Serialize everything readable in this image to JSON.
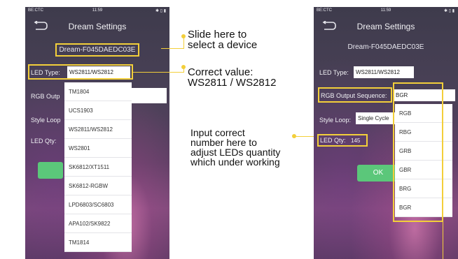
{
  "status": {
    "carrier": "BE:CTC",
    "time": "11:59",
    "icons": "✱ ▯ ▮"
  },
  "nav": {
    "title": "Dream Settings"
  },
  "device_name": "Dream-F045DAEDC03E",
  "left": {
    "led_type_label": "LED Type:",
    "led_type_value": "WS2811/WS2812",
    "rgb_label": "RGB Outp",
    "style_label": "Style Loop",
    "qty_label": "LED Qty:",
    "options": [
      "TM1804",
      "UCS1903",
      "WS2811/WS2812",
      "WS2801",
      "SK6812/XT1511",
      "SK6812-RGBW",
      "LPD6803/SC6803",
      "APA102/SK9822",
      "TM1814"
    ]
  },
  "right": {
    "led_type_label": "LED Type:",
    "led_type_value": "WS2811/WS2812",
    "rgb_label": "RGB Output Sequence:",
    "rgb_value": "BGR",
    "style_label": "Style Loop:",
    "style_value": "Single Cycle",
    "qty_label": "LED Qty:",
    "qty_value": "145",
    "ok_label": "OK",
    "options": [
      "RGB",
      "RBG",
      "GRB",
      "GBR",
      "BRG",
      "BGR"
    ]
  },
  "annotations": {
    "slide_1": "Slide here to",
    "slide_2": "select a device",
    "correct_1": "Correct value:",
    "correct_2": "WS2811 / WS2812",
    "input_1": "Input correct",
    "input_2": "number here to",
    "input_3": "adjust LEDs quantity",
    "input_4": "which under working"
  },
  "colors": {
    "highlight": "#f3cf3a",
    "ok_button": "#5bc77a"
  },
  "icons": [
    "back-icon"
  ]
}
